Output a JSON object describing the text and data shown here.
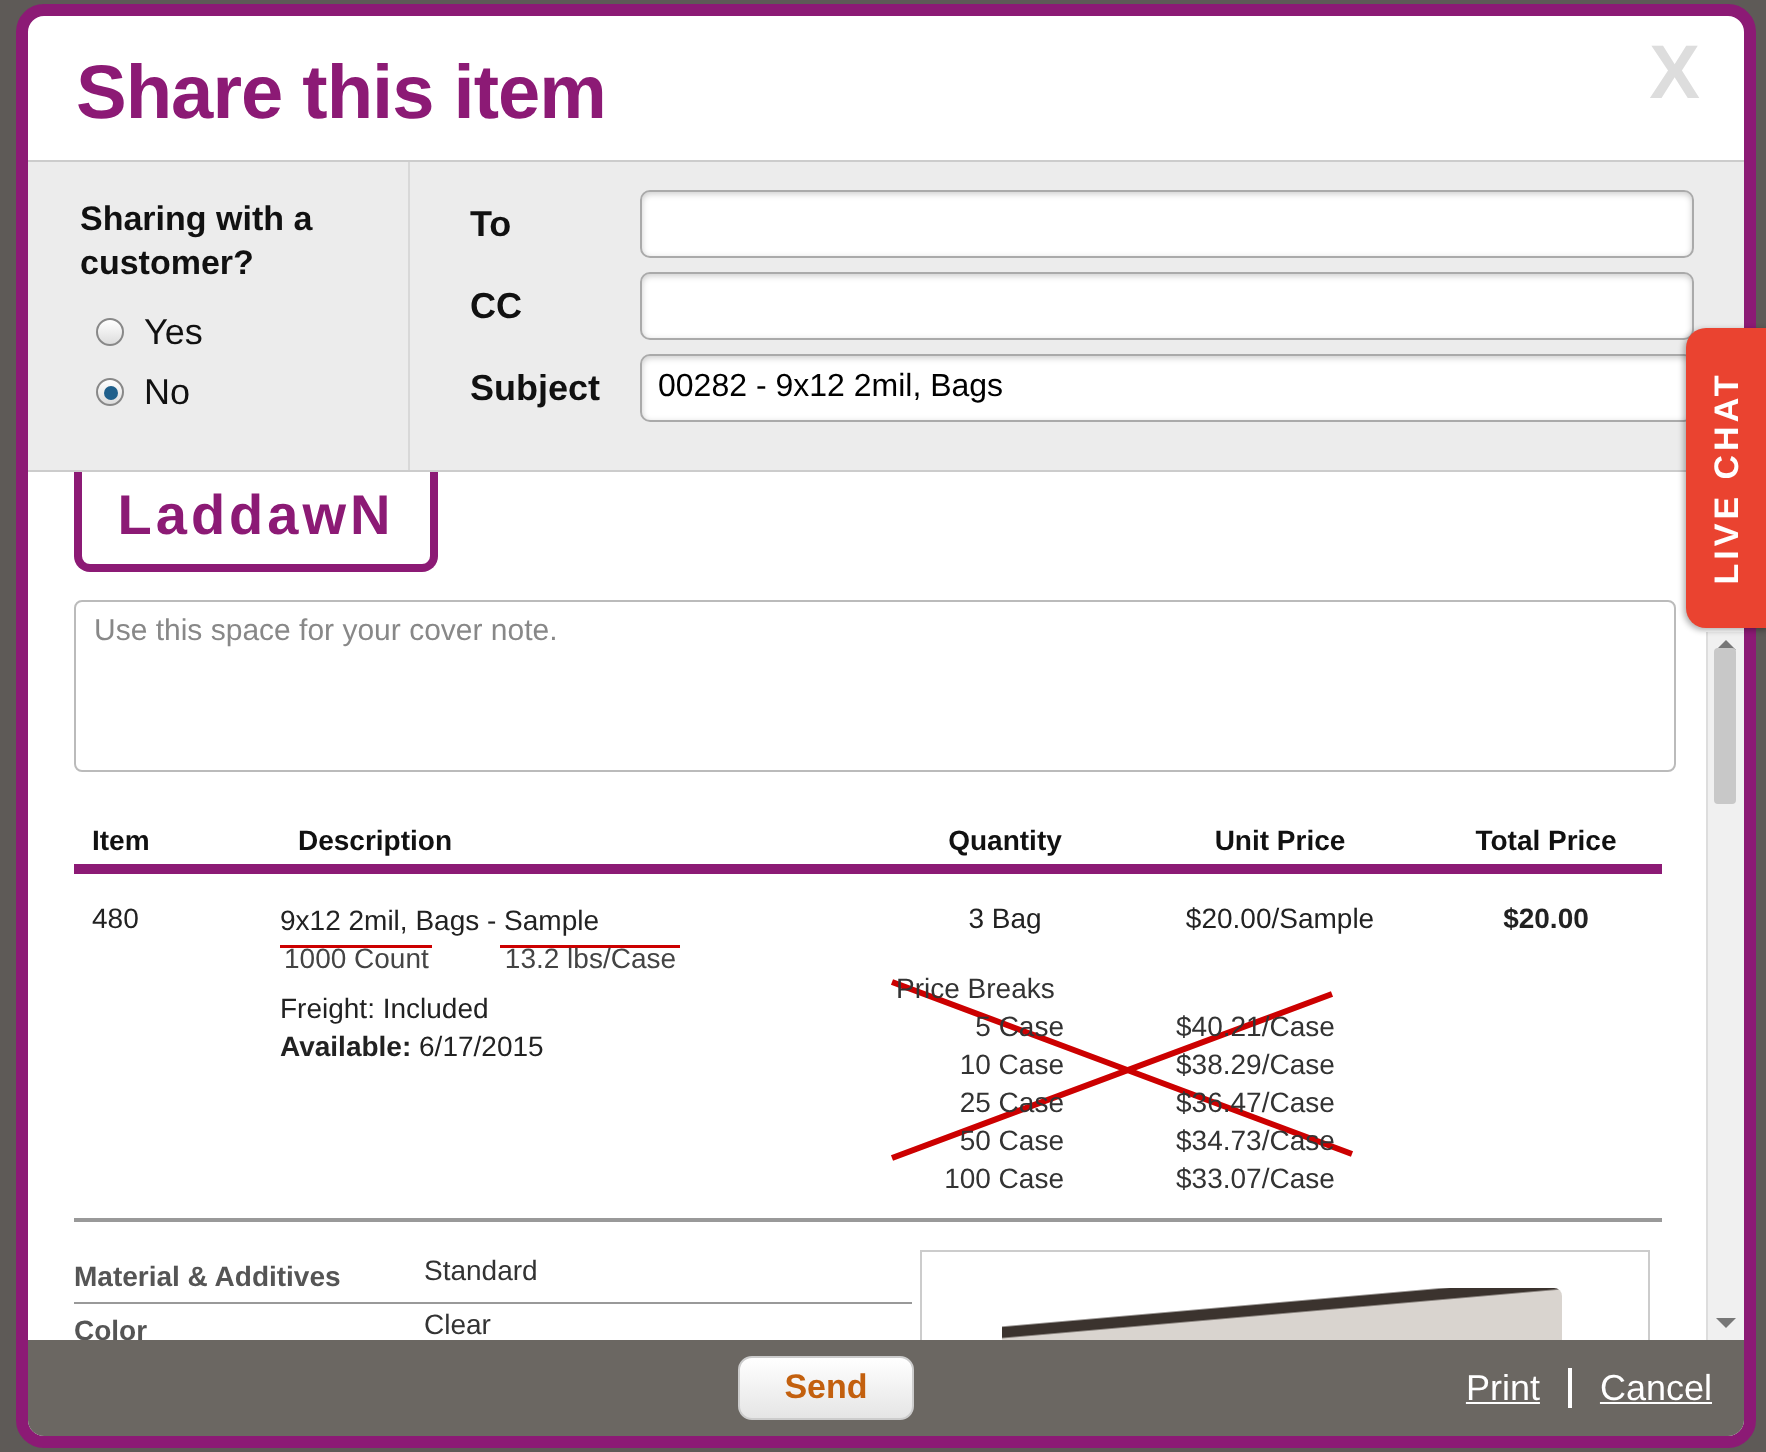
{
  "dialog": {
    "title": "Share this item",
    "close": "X"
  },
  "sharing": {
    "question": "Sharing with a customer?",
    "options": [
      {
        "label": "Yes",
        "selected": false
      },
      {
        "label": "No",
        "selected": true
      }
    ]
  },
  "fields": [
    {
      "label": "To"
    },
    {
      "label": "CC"
    },
    {
      "label": "Subject",
      "value": "00282 - 9x12 2mil, Bags"
    }
  ],
  "logo": {
    "text": "LaddawN"
  },
  "cover_note": {
    "placeholder": "Use this space for your cover note."
  },
  "table": {
    "columns": [
      "Item",
      "Description",
      "Quantity",
      "Unit Price",
      "Total Price"
    ],
    "rows": [
      {
        "item": "480",
        "description": "9x12 2mil, Bags - Sample",
        "specs": [
          {
            "text": "1000 Count",
            "struck": true
          },
          {
            "text": "13.2 lbs/Case",
            "struck": true
          }
        ],
        "freight": "Freight:  Included",
        "available": "**Available:** 6/17/2015",
        "quantity": "3 Bag",
        "unit_price": "$20.00/Sample",
        "total_price": "$20.00",
        "price_breaks": {
          "title": "Price Breaks",
          "crossed_out": true,
          "rows": [
            {
              "quantity": "5 Case",
              "price": "$40.21/Case"
            },
            {
              "quantity": "10 Case",
              "price": "$38.29/Case"
            },
            {
              "quantity": "25 Case",
              "price": "$36.47/Case"
            },
            {
              "quantity": "50 Case",
              "price": "$34.73/Case"
            },
            {
              "quantity": "100 Case",
              "price": "$33.07/Case"
            }
          ]
        }
      }
    ]
  },
  "properties": [
    {
      "name": "Material & Additives",
      "value": "Standard"
    },
    {
      "name": "Color",
      "value": "Clear"
    }
  ],
  "footer": {
    "send": "Send",
    "links": [
      "Print",
      "Cancel"
    ]
  },
  "live_chat": {
    "label": "LIVE CHAT"
  }
}
